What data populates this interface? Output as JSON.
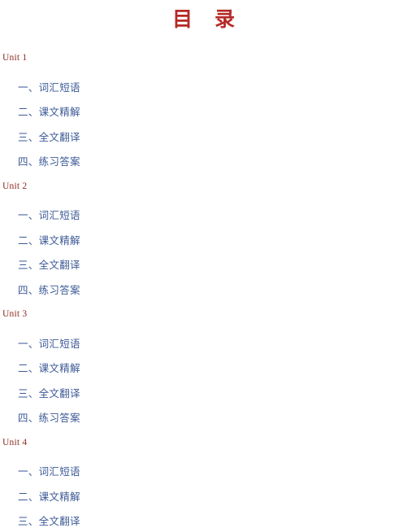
{
  "document": {
    "title": "目　录",
    "background_color": "#ffffff",
    "title_color": "#b52a27",
    "unit_heading_color": "#8e2a20",
    "item_color": "#3d5a96"
  },
  "toc": {
    "units": [
      {
        "label": "Unit 1",
        "items": [
          "一、词汇短语",
          "二、课文精解",
          "三、全文翻译",
          "四、练习答案"
        ]
      },
      {
        "label": "Unit 2",
        "items": [
          "一、词汇短语",
          "二、课文精解",
          "三、全文翻译",
          "四、练习答案"
        ]
      },
      {
        "label": "Unit 3",
        "items": [
          "一、词汇短语",
          "二、课文精解",
          "三、全文翻译",
          "四、练习答案"
        ]
      },
      {
        "label": "Unit 4",
        "items": [
          "一、词汇短语",
          "二、课文精解",
          "三、全文翻译"
        ]
      }
    ]
  }
}
